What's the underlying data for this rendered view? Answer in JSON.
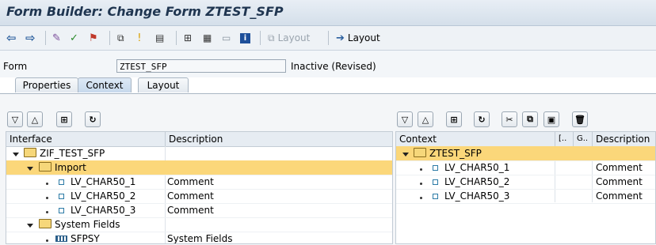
{
  "window": {
    "title": "Form Builder: Change Form ZTEST_SFP"
  },
  "toolbar": {
    "icons": [
      "back-icon",
      "forward-icon",
      "edit-icon",
      "check-icon",
      "activate-icon",
      "other-object-icon",
      "where-used-icon",
      "display-object-icon",
      "hierarchy-icon",
      "print-icon",
      "layout-preview-icon",
      "info-icon"
    ],
    "layout_disabled_label": "Layout",
    "layout_label": "Layout"
  },
  "form": {
    "label": "Form",
    "value": "ZTEST_SFP",
    "status": "Inactive (Revised)"
  },
  "tabs": [
    {
      "label": "Properties",
      "active": false
    },
    {
      "label": "Context",
      "active": true
    },
    {
      "label": "Layout",
      "active": false
    }
  ],
  "interface_tree": {
    "columns": [
      "Interface",
      "Description"
    ],
    "rows": [
      {
        "text": "ZIF_TEST_SFP",
        "desc": "",
        "type": "folder",
        "selected": false
      },
      {
        "text": "Import",
        "desc": "",
        "type": "folder",
        "selected": true
      },
      {
        "text": "LV_CHAR50_1",
        "desc": "Comment",
        "type": "leaf",
        "selected": false
      },
      {
        "text": "LV_CHAR50_2",
        "desc": "Comment",
        "type": "leaf",
        "selected": false
      },
      {
        "text": "LV_CHAR50_3",
        "desc": "Comment",
        "type": "leaf",
        "selected": false
      },
      {
        "text": "System Fields",
        "desc": "",
        "type": "folder",
        "selected": false
      },
      {
        "text": "SFPSY",
        "desc": "System Fields",
        "type": "struct",
        "selected": false
      }
    ]
  },
  "context_tree": {
    "columns": [
      "Context",
      "[..",
      "G..",
      "Description"
    ],
    "rows": [
      {
        "text": "ZTEST_SFP",
        "desc": "",
        "type": "folder",
        "selected": true
      },
      {
        "text": "LV_CHAR50_1",
        "desc": "Comment",
        "type": "leaf",
        "selected": false
      },
      {
        "text": "LV_CHAR50_2",
        "desc": "Comment",
        "type": "leaf",
        "selected": false
      },
      {
        "text": "LV_CHAR50_3",
        "desc": "Comment",
        "type": "leaf",
        "selected": false
      }
    ]
  },
  "colors": {
    "selected_row": "#fbd77a",
    "title_text": "#1f3550",
    "folder": "#f6d77a"
  }
}
